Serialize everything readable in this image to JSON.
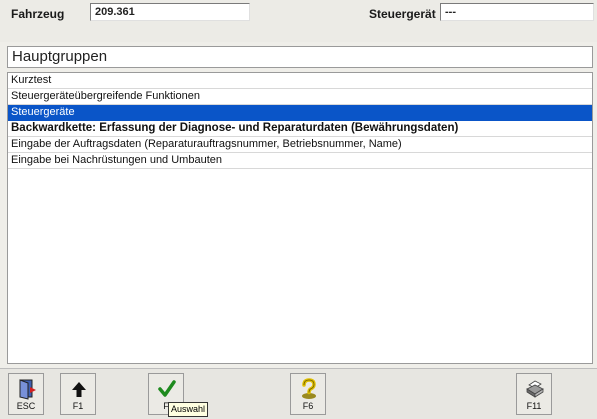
{
  "header": {
    "vehicle_label": "Fahrzeug",
    "vehicle_value": "209.361",
    "ecu_label": "Steuergerät",
    "ecu_value": "---"
  },
  "section_title": "Hauptgruppen",
  "menu": {
    "items": [
      {
        "label": "Kurztest"
      },
      {
        "label": "Steuergeräteübergreifende Funktionen"
      },
      {
        "label": "Steuergeräte",
        "selected": true
      },
      {
        "label": "Backwardkette: Erfassung der Diagnose- und Reparaturdaten (Bewährungsdaten)",
        "bold": true
      },
      {
        "label": "Eingabe der Auftragsdaten (Reparaturauftragsnummer, Betriebsnummer, Name)"
      },
      {
        "label": "Eingabe bei Nachrüstungen und Umbauten"
      }
    ],
    "selected_color": "#0a55c8"
  },
  "toolbar": {
    "keys": [
      {
        "label": "ESC",
        "icon": "exit-door-icon"
      },
      {
        "label": "F1",
        "icon": "up-arrow-icon"
      },
      {
        "label": "F",
        "icon": "checkmark-icon"
      },
      {
        "label": "F6",
        "icon": "help-question-icon"
      },
      {
        "label": "F11",
        "icon": "printer-icon"
      }
    ],
    "tooltip": "Auswahl"
  }
}
